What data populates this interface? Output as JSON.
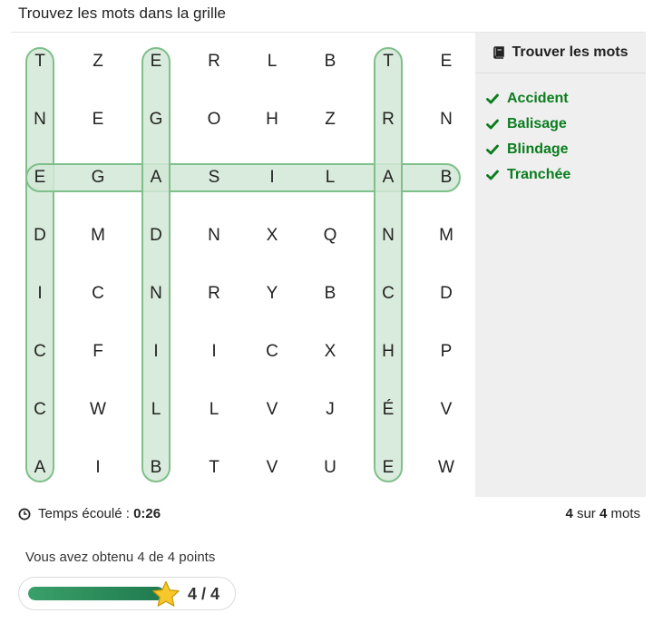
{
  "title": "Trouvez les mots dans la grille",
  "grid": [
    [
      "T",
      "Z",
      "E",
      "R",
      "L",
      "B",
      "T",
      "E"
    ],
    [
      "N",
      "E",
      "G",
      "O",
      "H",
      "Z",
      "R",
      "N"
    ],
    [
      "E",
      "G",
      "A",
      "S",
      "I",
      "L",
      "A",
      "B"
    ],
    [
      "D",
      "M",
      "D",
      "N",
      "X",
      "Q",
      "N",
      "M"
    ],
    [
      "I",
      "C",
      "N",
      "R",
      "Y",
      "B",
      "C",
      "D"
    ],
    [
      "C",
      "F",
      "I",
      "I",
      "C",
      "X",
      "H",
      "P"
    ],
    [
      "C",
      "W",
      "L",
      "L",
      "V",
      "J",
      "É",
      "V"
    ],
    [
      "A",
      "I",
      "B",
      "T",
      "V",
      "U",
      "E",
      "W"
    ]
  ],
  "found_words": [
    {
      "word": "Accident",
      "from": [
        7,
        0
      ],
      "to": [
        0,
        0
      ]
    },
    {
      "word": "Balisage",
      "from": [
        2,
        7
      ],
      "to": [
        2,
        0
      ]
    },
    {
      "word": "Blindage",
      "from": [
        7,
        2
      ],
      "to": [
        0,
        2
      ]
    },
    {
      "word": "Tranchée",
      "from": [
        0,
        6
      ],
      "to": [
        7,
        6
      ]
    }
  ],
  "panel": {
    "heading": "Trouver les mots",
    "heading_icon": "book-icon",
    "words": [
      "Accident",
      "Balisage",
      "Blindage",
      "Tranchée"
    ],
    "check_icon": "check-icon"
  },
  "footer": {
    "timer_icon": "clock-icon",
    "timer_label": "Temps écoulé :",
    "timer_value": "0:26",
    "found_count": "4",
    "count_sep": "sur",
    "total_count": "4",
    "count_suffix": "mots"
  },
  "score": {
    "text": "Vous avez obtenu 4 de 4 points",
    "value": "4 / 4",
    "progress": 1.0,
    "icon": "star-icon"
  },
  "colors": {
    "highlight_fill": "#d2e8d6",
    "highlight_stroke": "#7fbf8a",
    "found_text": "#0b7d1e",
    "panel_bg": "#efefef",
    "bar": "#2a8c59",
    "star": "#f7c82b"
  }
}
